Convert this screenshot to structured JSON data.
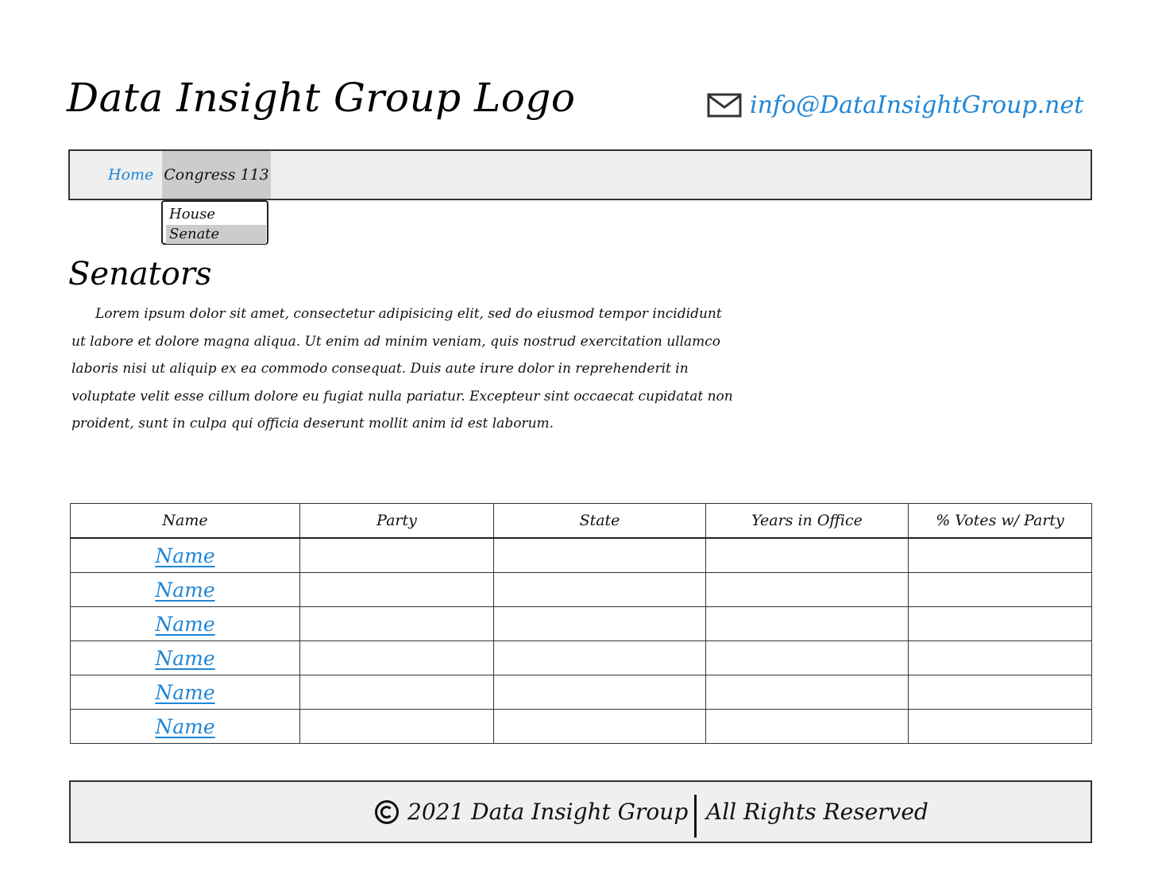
{
  "header": {
    "logo_text": "Data Insight Group Logo",
    "email": "info@DataInsightGroup.net",
    "email_icon": "envelope-icon"
  },
  "nav": {
    "home_label": "Home",
    "congress_label": "Congress 113",
    "dropdown_items": [
      "House",
      "Senate"
    ],
    "selected_item": "Senate"
  },
  "main": {
    "title": "Senators",
    "intro": "Lorem ipsum dolor sit amet, consectetur adipisicing elit, sed do eiusmod tempor incididunt ut labore et dolore magna aliqua. Ut enim ad minim veniam, quis nostrud exercitation ullamco laboris nisi ut aliquip ex ea commodo consequat. Duis aute irure dolor in reprehenderit in voluptate velit esse cillum dolore eu fugiat nulla pariatur. Excepteur sint occaecat cupidatat non proident, sunt in culpa qui officia deserunt mollit anim id est laborum."
  },
  "table": {
    "headers": [
      "Name",
      "Party",
      "State",
      "Years in Office",
      "% Votes w/ Party"
    ],
    "rows": [
      [
        "Name",
        "",
        "",
        "",
        ""
      ],
      [
        "Name",
        "",
        "",
        "",
        ""
      ],
      [
        "Name",
        "",
        "",
        "",
        ""
      ],
      [
        "Name",
        "",
        "",
        "",
        ""
      ],
      [
        "Name",
        "",
        "",
        "",
        ""
      ],
      [
        "Name",
        "",
        "",
        "",
        ""
      ]
    ]
  },
  "footer": {
    "copyright_text": "2021 Data Insight Group",
    "rights_text": "All Rights Reserved",
    "copyright_icon": "copyright-icon"
  },
  "colors": {
    "link": "#1f86d6",
    "nav_background": "#efefef",
    "nav_active": "#cccccc"
  }
}
